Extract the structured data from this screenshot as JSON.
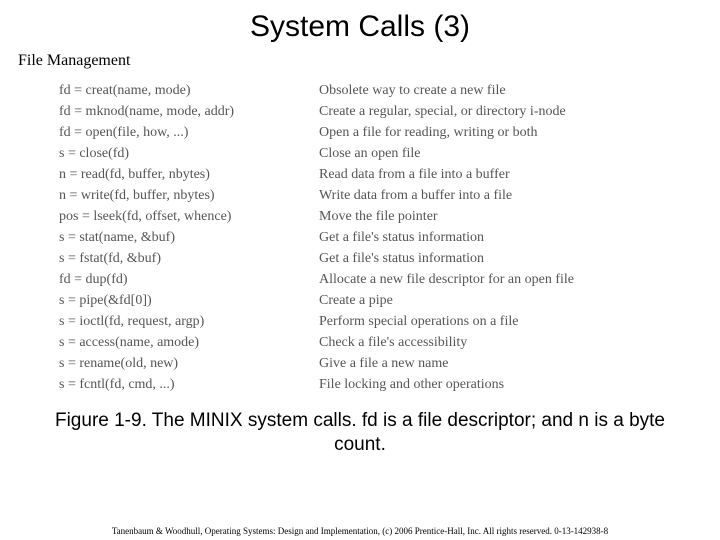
{
  "title": "System Calls (3)",
  "subtitle": "File Management",
  "rows": [
    {
      "call": "fd = creat(name, mode)",
      "desc": "Obsolete way to create a new file"
    },
    {
      "call": "fd = mknod(name, mode, addr)",
      "desc": "Create a regular, special, or directory i-node"
    },
    {
      "call": "fd = open(file, how, ...)",
      "desc": "Open a file for reading, writing or both"
    },
    {
      "call": "s = close(fd)",
      "desc": "Close an open file"
    },
    {
      "call": "n = read(fd, buffer, nbytes)",
      "desc": "Read data from a file into a buffer"
    },
    {
      "call": "n = write(fd, buffer, nbytes)",
      "desc": "Write data from a buffer into a file"
    },
    {
      "call": "pos = lseek(fd, offset, whence)",
      "desc": "Move the file pointer"
    },
    {
      "call": "s = stat(name, &buf)",
      "desc": "Get a file's status information"
    },
    {
      "call": "s = fstat(fd, &buf)",
      "desc": "Get a file's status information"
    },
    {
      "call": "fd = dup(fd)",
      "desc": "Allocate a new file descriptor for an open file"
    },
    {
      "call": "s = pipe(&fd[0])",
      "desc": "Create a pipe"
    },
    {
      "call": "s = ioctl(fd, request, argp)",
      "desc": "Perform special operations on a file"
    },
    {
      "call": "s = access(name, amode)",
      "desc": "Check a file's accessibility"
    },
    {
      "call": "s = rename(old, new)",
      "desc": "Give a file a new name"
    },
    {
      "call": "s = fcntl(fd, cmd, ...)",
      "desc": "File locking and other operations"
    }
  ],
  "caption": "Figure 1-9. The MINIX system calls. fd is a file descriptor; and n is a byte count.",
  "copyright": "Tanenbaum & Woodhull, Operating Systems: Design and Implementation, (c) 2006 Prentice-Hall, Inc. All rights reserved. 0-13-142938-8"
}
